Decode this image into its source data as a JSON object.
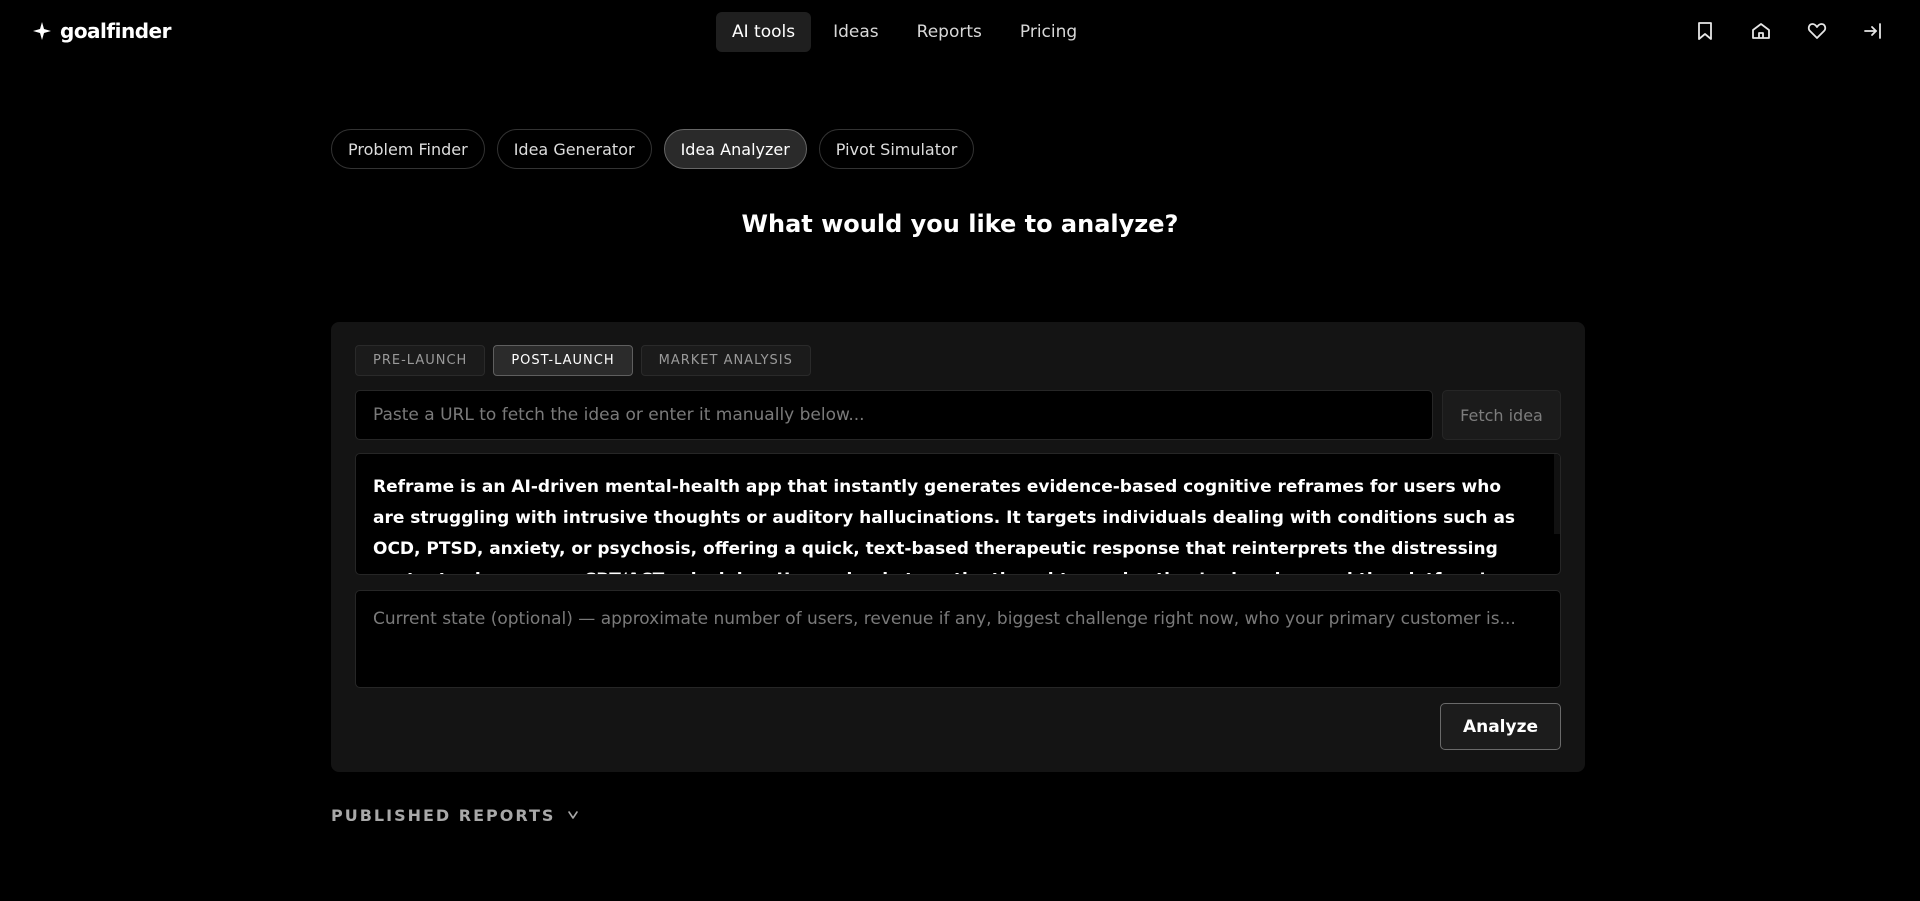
{
  "brand": {
    "name": "goalfinder",
    "icon": "sparkle-icon"
  },
  "nav": {
    "items": [
      {
        "label": "AI tools",
        "active": true
      },
      {
        "label": "Ideas",
        "active": false
      },
      {
        "label": "Reports",
        "active": false
      },
      {
        "label": "Pricing",
        "active": false
      }
    ]
  },
  "header_actions": [
    "bookmark-icon",
    "home-icon",
    "heart-icon",
    "logout-icon"
  ],
  "tools": {
    "items": [
      {
        "label": "Problem Finder",
        "active": false
      },
      {
        "label": "Idea Generator",
        "active": false
      },
      {
        "label": "Idea Analyzer",
        "active": true
      },
      {
        "label": "Pivot Simulator",
        "active": false
      }
    ]
  },
  "heading": "What would you like to analyze?",
  "modes": {
    "items": [
      {
        "label": "PRE-LAUNCH",
        "active": false
      },
      {
        "label": "POST-LAUNCH",
        "active": true
      },
      {
        "label": "MARKET ANALYSIS",
        "active": false
      }
    ]
  },
  "url_field": {
    "placeholder": "Paste a URL to fetch the idea or enter it manually below...",
    "value": ""
  },
  "fetch_button": "Fetch idea",
  "idea_text": "Reframe is an AI-driven mental-health app that instantly generates evidence-based cognitive reframes for users who are struggling with intrusive thoughts or auditory hallucinations. It targets individuals dealing with conditions such as OCD, PTSD, anxiety, or psychosis, offering a quick, text-based therapeutic response that reinterprets the distressing content using proven CBT/ACT principles. Users simply type the thought or voice they’re hearing, and the platform’s language model returns a concise, clinically informed reframe to help reduce distress and",
  "state_field": {
    "placeholder": "Current state (optional) — approximate number of users, revenue if any, biggest challenge right now, who your primary customer is...",
    "value": ""
  },
  "analyze_button": "Analyze",
  "published_reports": {
    "label": "PUBLISHED REPORTS",
    "icon": "chevron-down-icon"
  },
  "colors": {
    "background": "#000000",
    "card": "#141414",
    "text": "#ffffff",
    "muted": "#7a7a7a"
  }
}
